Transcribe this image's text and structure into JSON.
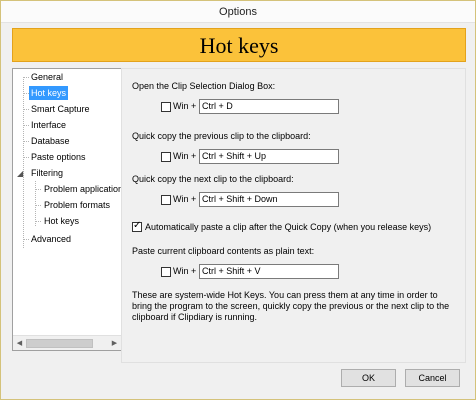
{
  "window": {
    "title": "Options"
  },
  "banner": {
    "title": "Hot keys"
  },
  "sidebar": {
    "items": [
      {
        "label": "General"
      },
      {
        "label": "Hot keys"
      },
      {
        "label": "Smart Capture"
      },
      {
        "label": "Interface"
      },
      {
        "label": "Database"
      },
      {
        "label": "Paste options"
      },
      {
        "label": "Filtering"
      },
      {
        "label": "Problem applications"
      },
      {
        "label": "Problem formats"
      },
      {
        "label": "Hot keys"
      },
      {
        "label": "Advanced"
      }
    ],
    "selected_index": 1,
    "expanded_node": "Filtering"
  },
  "hotkeys": [
    {
      "label": "Open the Clip Selection Dialog Box:",
      "win_label": "Win +",
      "win_checked": false,
      "keys": "Ctrl + D"
    },
    {
      "label": "Quick copy the previous clip to the clipboard:",
      "win_label": "Win +",
      "win_checked": false,
      "keys": "Ctrl + Shift + Up"
    },
    {
      "label": "Quick copy the next clip to the clipboard:",
      "win_label": "Win +",
      "win_checked": false,
      "keys": "Ctrl + Shift + Down"
    },
    {
      "label": "Paste current clipboard contents as plain text:",
      "win_label": "Win +",
      "win_checked": false,
      "keys": "Ctrl + Shift + V"
    }
  ],
  "auto_paste": {
    "label": "Automatically paste a clip after the Quick Copy (when you release keys)",
    "checked": true
  },
  "note": "These are system-wide Hot Keys. You can press them at any time in order to bring the program to the screen, quickly copy the previous or the next clip to the clipboard if Clipdiary is running.",
  "buttons": {
    "ok": "OK",
    "cancel": "Cancel"
  },
  "colors": {
    "banner": "#fbc23a",
    "selection": "#3399ff"
  }
}
